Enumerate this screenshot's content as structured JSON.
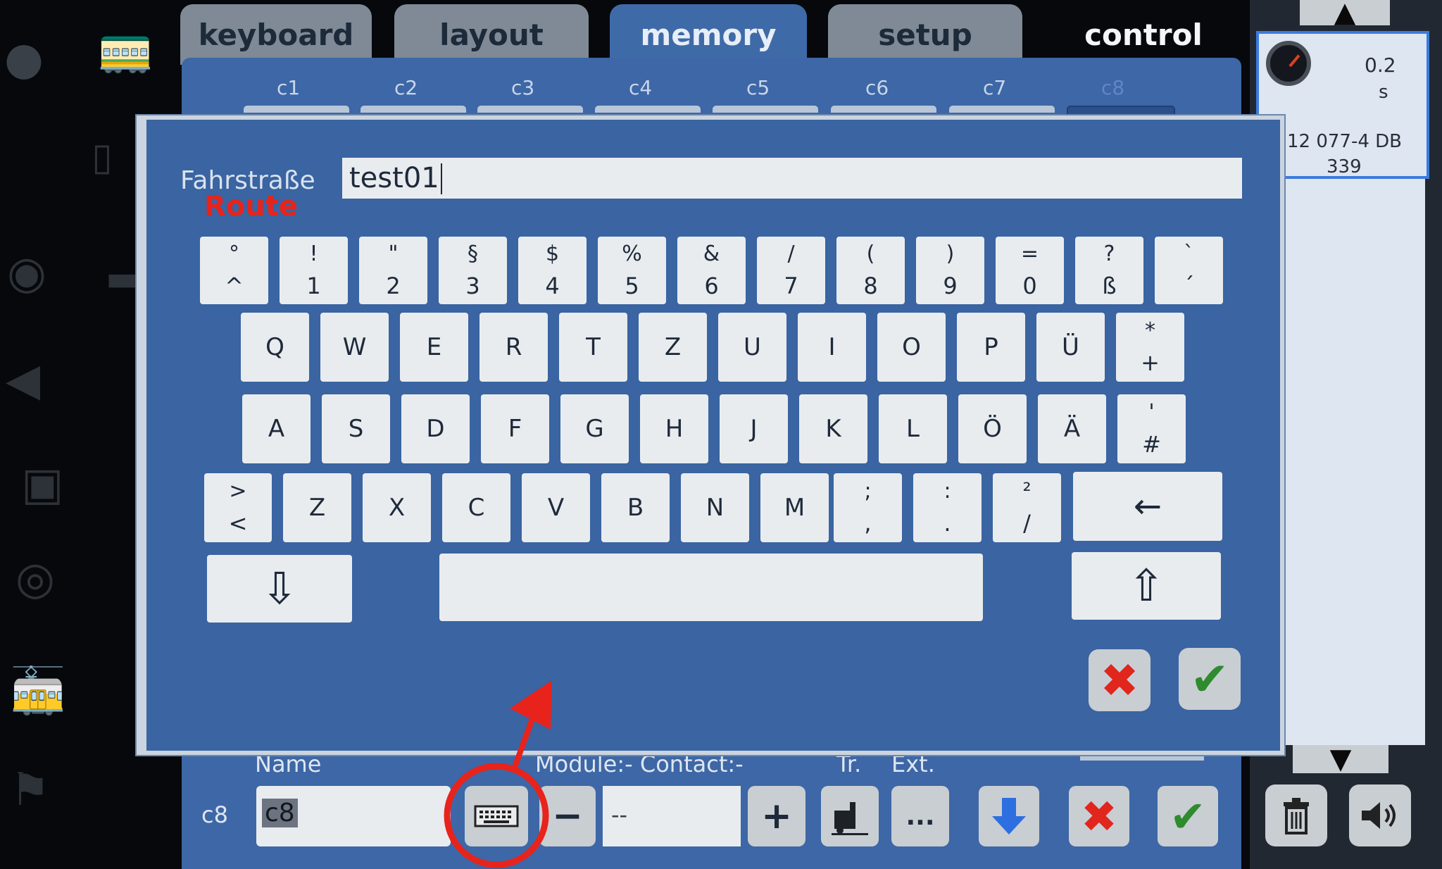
{
  "tabs": [
    "keyboard",
    "layout",
    "memory",
    "setup",
    "control"
  ],
  "active_tab": "memory",
  "subtabs": [
    "c1",
    "c2",
    "c3",
    "c4",
    "c5",
    "c6",
    "c7",
    "c8"
  ],
  "active_subtab": "c8",
  "loco": {
    "delay_value": "0.2",
    "delay_unit": "s",
    "name": "12 077-4 DB",
    "number": "339"
  },
  "dialog": {
    "field_label": "Fahrstraße",
    "field_annotation": "Route",
    "field_value": "test01"
  },
  "keyboard": {
    "row1": [
      {
        "top": "°",
        "bot": "^"
      },
      {
        "top": "!",
        "bot": "1"
      },
      {
        "top": "\"",
        "bot": "2"
      },
      {
        "top": "§",
        "bot": "3"
      },
      {
        "top": "$",
        "bot": "4"
      },
      {
        "top": "%",
        "bot": "5"
      },
      {
        "top": "&",
        "bot": "6"
      },
      {
        "top": "/",
        "bot": "7"
      },
      {
        "top": "(",
        "bot": "8"
      },
      {
        "top": ")",
        "bot": "9"
      },
      {
        "top": "=",
        "bot": "0"
      },
      {
        "top": "?",
        "bot": "ß"
      },
      {
        "top": "`",
        "bot": "´"
      }
    ],
    "row2": [
      "Q",
      "W",
      "E",
      "R",
      "T",
      "Z",
      "U",
      "I",
      "O",
      "P",
      "Ü"
    ],
    "row2_last": {
      "top": "*",
      "bot": "+"
    },
    "row3": [
      "A",
      "S",
      "D",
      "F",
      "G",
      "H",
      "J",
      "K",
      "L",
      "Ö",
      "Ä"
    ],
    "row3_last": {
      "top": "'",
      "bot": "#"
    },
    "row4_first": {
      "top": ">",
      "bot": "<"
    },
    "row4": [
      "Z",
      "X",
      "C",
      "V",
      "B",
      "N",
      "M"
    ],
    "row4_sym": [
      {
        "top": ";",
        "bot": ","
      },
      {
        "top": ":",
        "bot": "."
      },
      {
        "top": "²",
        "bot": "/"
      }
    ],
    "backspace": "←",
    "hide_keyboard": "⇩",
    "shift": "⇧"
  },
  "bottom": {
    "name_label": "Name",
    "module_label": "Module:- Contact:-",
    "tr_label": "Tr.",
    "ext_label": "Ext.",
    "row_id": "c8",
    "name_value": "c8",
    "contact_value": "--",
    "minus": "−",
    "plus": "+",
    "more": "..."
  },
  "colors": {
    "panel_blue": "#3d67a6",
    "annotation_red": "#e8231b",
    "cancel_red": "#e0261d",
    "confirm_green": "#2e8b2e",
    "down_arrow_blue": "#2d6fe0"
  },
  "icons": {
    "cancel": "✖",
    "confirm": "✔",
    "down": "⬇",
    "trash": "🗑",
    "speaker": "🔊",
    "gauge": "gauge-icon"
  }
}
